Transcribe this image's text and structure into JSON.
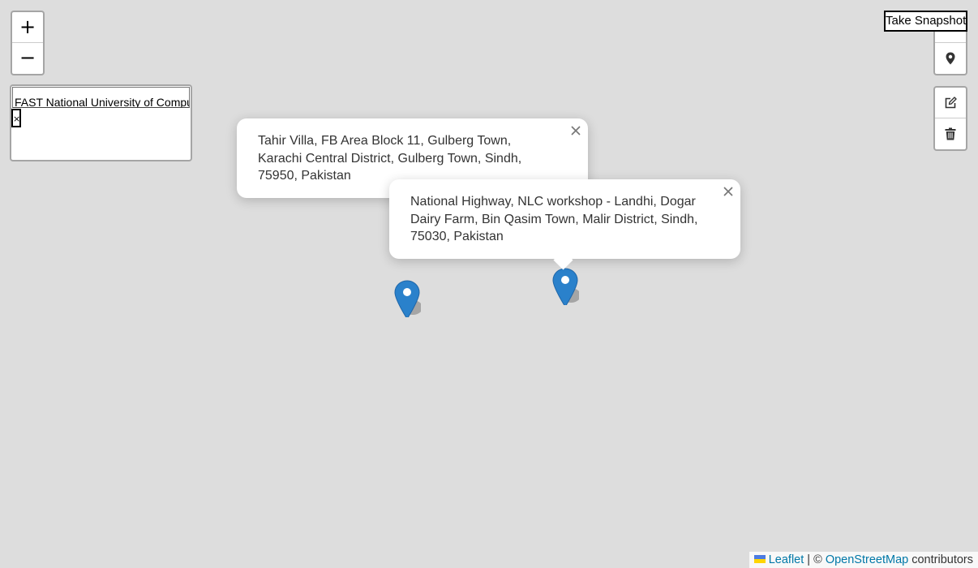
{
  "zoom": {
    "in_label": "+",
    "out_label": "−"
  },
  "search": {
    "value": "FAST National University of Computer and Emerging Sciences",
    "cancel_label": "×"
  },
  "snapshot": {
    "label": "Take Snapshot"
  },
  "controls": {
    "locate_icon": "map-pin-icon",
    "edit_icon": "edit-icon",
    "delete_icon": "trash-icon"
  },
  "popups": [
    {
      "text": "Tahir Villa, FB Area Block 11, Gulberg Town, Karachi Central District, Gulberg Town, Sindh, 75950, Pakistan",
      "close_label": "×"
    },
    {
      "text": "National Highway, NLC workshop - Landhi, Dogar Dairy Farm, Bin Qasim Town, Malir District, Sindh, 75030, Pakistan",
      "close_label": "×"
    }
  ],
  "markers": [
    {
      "icon": "map-marker-icon",
      "color": "#2a81cb"
    },
    {
      "icon": "map-marker-icon",
      "color": "#2a81cb"
    }
  ],
  "attribution": {
    "leaflet": "Leaflet",
    "separator": " | © ",
    "osm": "OpenStreetMap",
    "suffix": " contributors"
  },
  "colors": {
    "map_bg": "#dddddd",
    "link": "#0078a8",
    "marker": "#2a81cb"
  }
}
